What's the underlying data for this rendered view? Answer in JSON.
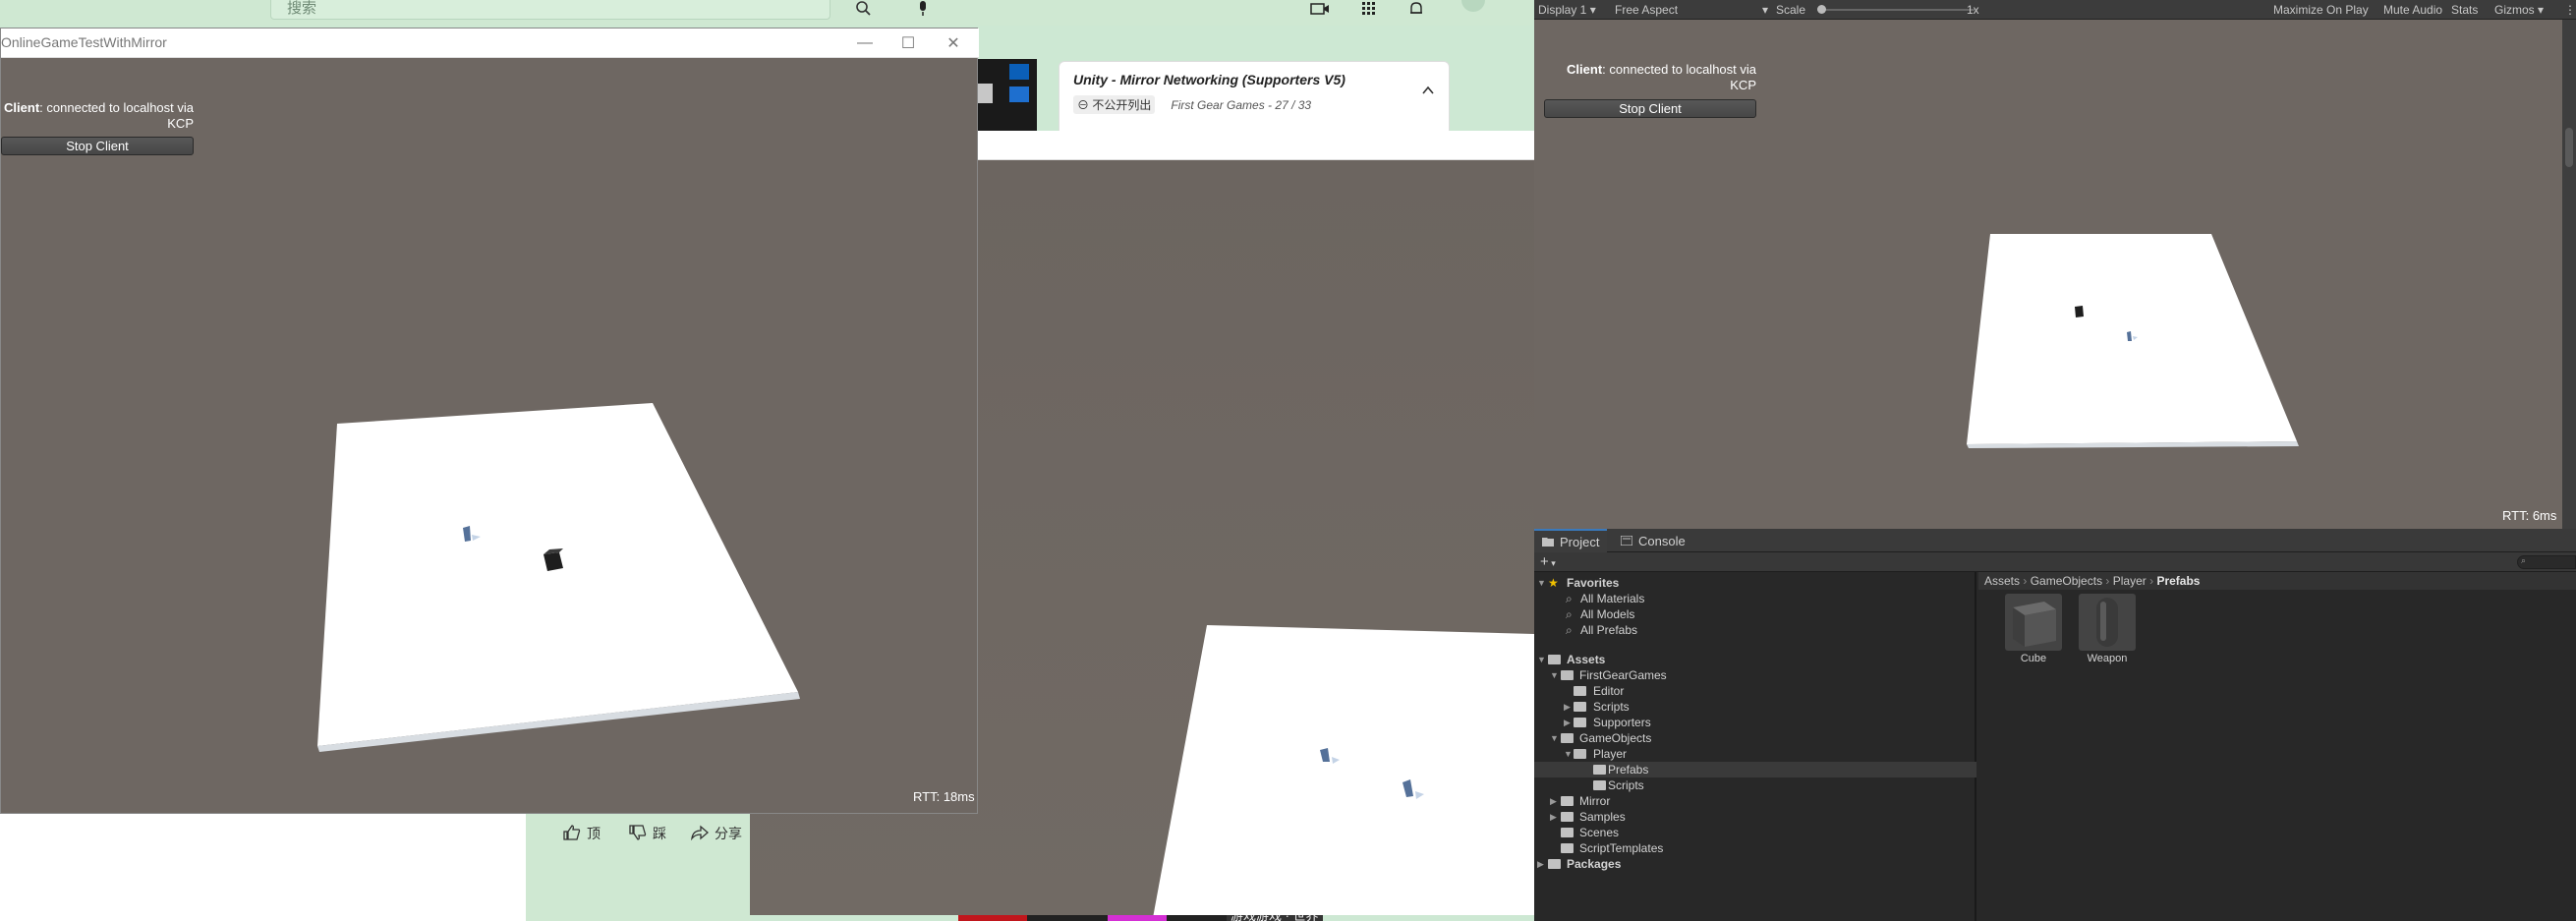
{
  "browser": {
    "search_placeholder": "搜索",
    "playlist": {
      "title": "Unity - Mirror Networking (Supporters V5)",
      "visibility": "不公开列出",
      "meta": "First Gear Games - 27 / 33"
    },
    "actions": [
      {
        "icon": "thumbs-up-icon",
        "label": "顶"
      },
      {
        "icon": "thumbs-down-icon",
        "label": "踩"
      },
      {
        "icon": "share-icon",
        "label": "分享"
      }
    ],
    "thumb_caption": "游戏游戏 · 世界"
  },
  "game_window": {
    "title": "OnlineGameTestWithMirror",
    "status_prefix": "Client",
    "status_text": ": connected to localhost via",
    "status_line2": "KCP",
    "stop_button": "Stop Client",
    "rtt": "RTT: 18ms"
  },
  "editor_game_view": {
    "status_prefix": "Client",
    "status_text": ": connected to localhost via",
    "status_line2": "KCP",
    "stop_button": "Stop Client",
    "rtt": "RTT: 6ms"
  },
  "toolbar": {
    "display": "Display 1",
    "aspect": "Free Aspect",
    "scale_label": "Scale",
    "scale_value": "1x",
    "maximize": "Maximize On Play",
    "mute": "Mute Audio",
    "stats": "Stats",
    "gizmos": "Gizmos"
  },
  "project_panel": {
    "tabs": [
      "Project",
      "Console"
    ],
    "add_label": "+",
    "favorites_header": "Favorites",
    "favorites": [
      "All Materials",
      "All Models",
      "All Prefabs"
    ],
    "assets_header": "Assets",
    "tree": {
      "first_gear_games": "FirstGearGames",
      "editor": "Editor",
      "scripts1": "Scripts",
      "supporters": "Supporters",
      "game_objects": "GameObjects",
      "player": "Player",
      "prefabs": "Prefabs",
      "scripts2": "Scripts",
      "mirror": "Mirror",
      "samples": "Samples",
      "scenes": "Scenes",
      "script_templates": "ScriptTemplates",
      "packages": "Packages"
    },
    "breadcrumb": [
      "Assets",
      "GameObjects",
      "Player",
      "Prefabs"
    ],
    "assets": [
      "Cube",
      "Weapon"
    ]
  }
}
